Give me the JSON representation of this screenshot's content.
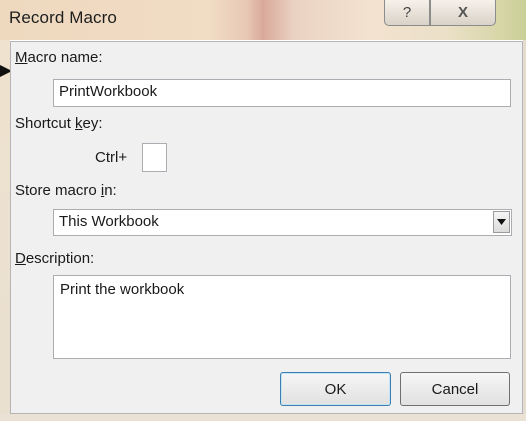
{
  "dialog": {
    "title": "Record Macro",
    "help_button": "?",
    "close_button": "X"
  },
  "macro_name": {
    "label_accel": "M",
    "label_rest": "acro name:",
    "value": "PrintWorkbook"
  },
  "shortcut": {
    "label_pre": "Shortcut ",
    "label_accel": "k",
    "label_post": "ey:",
    "prefix": "Ctrl+",
    "value": ""
  },
  "store": {
    "label_pre": "Store macro ",
    "label_accel": "i",
    "label_post": "n:",
    "selected": "This Workbook"
  },
  "description": {
    "label_accel": "D",
    "label_rest": "escription:",
    "value": "Print the workbook"
  },
  "buttons": {
    "ok": "OK",
    "cancel": "Cancel"
  }
}
